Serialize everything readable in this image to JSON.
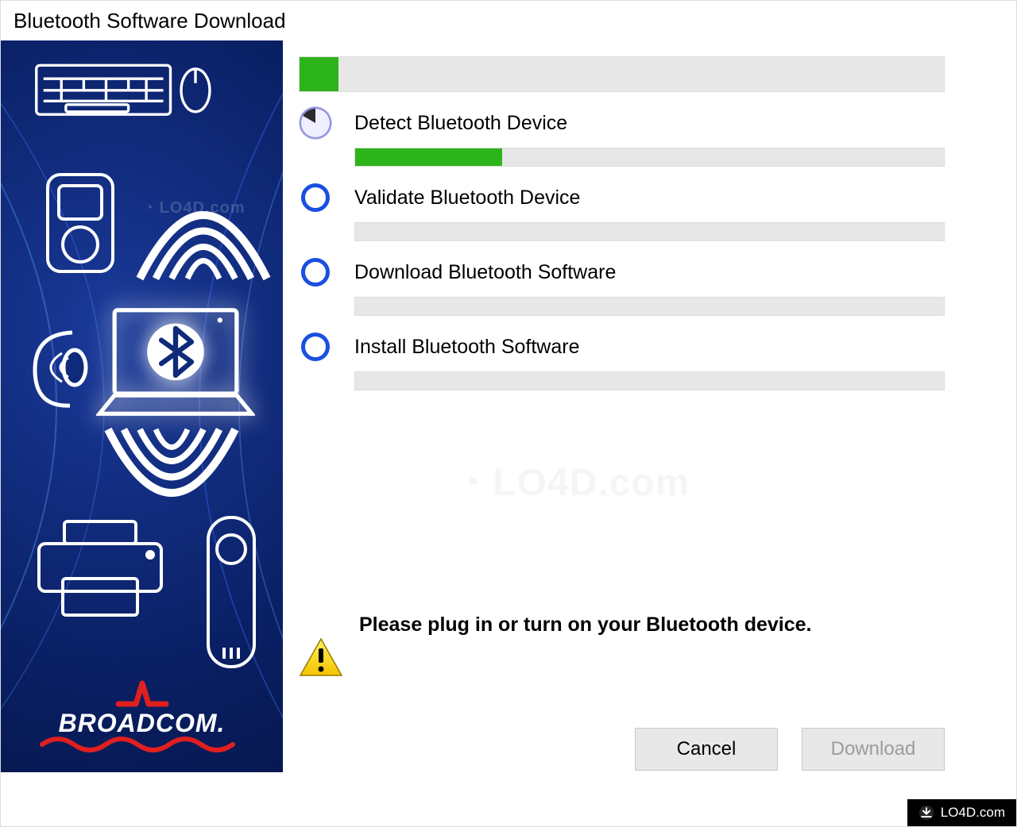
{
  "window": {
    "title": "Bluetooth Software Download"
  },
  "progress": {
    "overall_percent": 6
  },
  "steps": [
    {
      "label": "Detect Bluetooth Device",
      "state": "active",
      "progress_percent": 25
    },
    {
      "label": "Validate Bluetooth Device",
      "state": "pending",
      "progress_percent": 0
    },
    {
      "label": "Download Bluetooth Software",
      "state": "pending",
      "progress_percent": 0
    },
    {
      "label": "Install Bluetooth Software",
      "state": "pending",
      "progress_percent": 0
    }
  ],
  "warning": {
    "message": "Please plug in or turn on your Bluetooth device."
  },
  "buttons": {
    "cancel": "Cancel",
    "download": "Download",
    "download_enabled": false
  },
  "branding": {
    "vendor": "BROADCOM."
  },
  "footer": {
    "site": "LO4D.com"
  },
  "colors": {
    "sidebar_bg": "#0f2a7a",
    "progress_green": "#2eb41b",
    "ring_blue": "#1a4fe0",
    "broadcom_red": "#e01f1f"
  }
}
